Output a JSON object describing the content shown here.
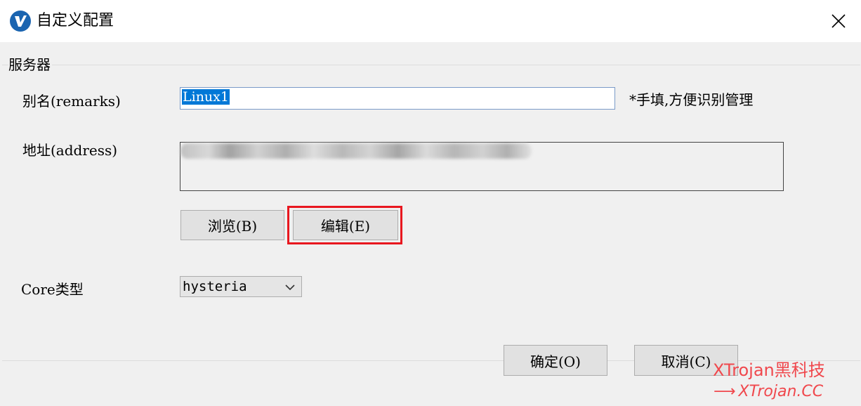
{
  "window": {
    "title": "自定义配置",
    "app_icon_letter": "V",
    "close_icon": "close-icon"
  },
  "group": {
    "title": "服务器"
  },
  "fields": {
    "alias_label": "别名(remarks)",
    "alias_value": "Linux1",
    "alias_hint": "*手填,方便识别管理",
    "address_label": "地址(address)",
    "core_label": "Core类型",
    "core_value": "hysteria"
  },
  "buttons": {
    "browse": "浏览(B)",
    "edit": "编辑(E)",
    "ok": "确定(O)",
    "cancel": "取消(C)"
  },
  "watermark": {
    "line1": "XTrojan黑科技",
    "line2": "XTrojan.CC",
    "arrow": "⟶"
  },
  "colors": {
    "highlight": "#e8171f",
    "selection": "#0078d7",
    "watermark": "#f0484d"
  }
}
